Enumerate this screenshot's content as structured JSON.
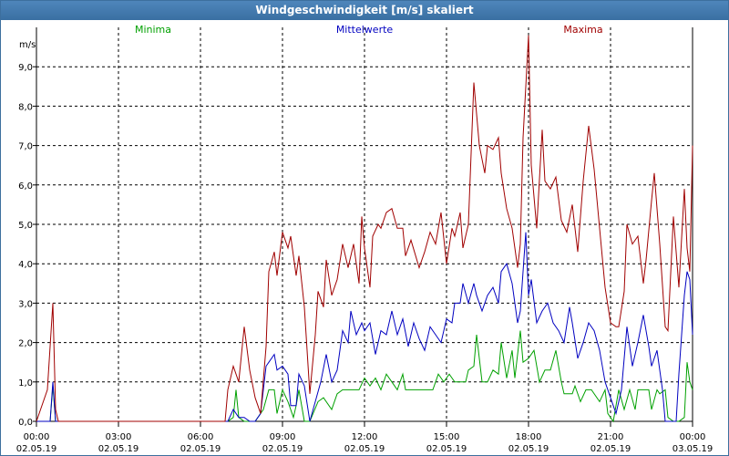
{
  "window": {
    "title": "Windgeschwindigkeit [m/s] skaliert"
  },
  "chart_data": {
    "type": "line",
    "title": "Windgeschwindigkeit [m/s] skaliert",
    "ylabel": "m/s",
    "ylim": [
      0,
      10
    ],
    "xlim": [
      0,
      24
    ],
    "grid": true,
    "legend_position": "top",
    "y_ticks": [
      {
        "value": 0,
        "label": "0,0"
      },
      {
        "value": 1,
        "label": "1,0"
      },
      {
        "value": 2,
        "label": "2,0"
      },
      {
        "value": 3,
        "label": "3,0"
      },
      {
        "value": 4,
        "label": "4,0"
      },
      {
        "value": 5,
        "label": "5,0"
      },
      {
        "value": 6,
        "label": "6,0"
      },
      {
        "value": 7,
        "label": "7,0"
      },
      {
        "value": 8,
        "label": "8,0"
      },
      {
        "value": 9,
        "label": "9,0"
      }
    ],
    "x_ticks": [
      {
        "value": 0,
        "time": "00:00",
        "date": "02.05.19"
      },
      {
        "value": 3,
        "time": "03:00",
        "date": "02.05.19"
      },
      {
        "value": 6,
        "time": "06:00",
        "date": "02.05.19"
      },
      {
        "value": 9,
        "time": "09:00",
        "date": "02.05.19"
      },
      {
        "value": 12,
        "time": "12:00",
        "date": "02.05.19"
      },
      {
        "value": 15,
        "time": "15:00",
        "date": "02.05.19"
      },
      {
        "value": 18,
        "time": "18:00",
        "date": "02.05.19"
      },
      {
        "value": 21,
        "time": "21:00",
        "date": "02.05.19"
      },
      {
        "value": 24,
        "time": "00:00",
        "date": "03.05.19"
      }
    ],
    "series": [
      {
        "name": "Minima",
        "color": "#00a000",
        "points": [
          [
            0,
            0
          ],
          [
            0.5,
            0
          ],
          [
            0.6,
            0.9
          ],
          [
            0.7,
            0
          ],
          [
            1,
            0
          ],
          [
            6.5,
            0
          ],
          [
            7,
            0
          ],
          [
            7.2,
            0.1
          ],
          [
            7.3,
            0.8
          ],
          [
            7.4,
            0.1
          ],
          [
            7.6,
            0
          ],
          [
            8,
            0
          ],
          [
            8.3,
            0.3
          ],
          [
            8.5,
            0.8
          ],
          [
            8.7,
            0.8
          ],
          [
            8.8,
            0.2
          ],
          [
            9,
            0.8
          ],
          [
            9.2,
            0.5
          ],
          [
            9.4,
            0.1
          ],
          [
            9.5,
            0.4
          ],
          [
            9.6,
            0.8
          ],
          [
            9.8,
            0
          ],
          [
            10,
            0
          ],
          [
            10.3,
            0.5
          ],
          [
            10.5,
            0.6
          ],
          [
            10.8,
            0.3
          ],
          [
            11,
            0.7
          ],
          [
            11.2,
            0.8
          ],
          [
            11.5,
            0.8
          ],
          [
            11.8,
            0.8
          ],
          [
            12,
            1.1
          ],
          [
            12.2,
            0.9
          ],
          [
            12.4,
            1.1
          ],
          [
            12.6,
            0.8
          ],
          [
            12.8,
            1.2
          ],
          [
            13,
            1
          ],
          [
            13.2,
            0.8
          ],
          [
            13.4,
            1.2
          ],
          [
            13.5,
            0.8
          ],
          [
            14,
            0.8
          ],
          [
            14.5,
            0.8
          ],
          [
            14.7,
            1.2
          ],
          [
            14.9,
            1
          ],
          [
            15.1,
            1.2
          ],
          [
            15.3,
            1
          ],
          [
            15.5,
            1
          ],
          [
            15.7,
            1
          ],
          [
            15.8,
            1.3
          ],
          [
            16,
            1.4
          ],
          [
            16.1,
            2.2
          ],
          [
            16.3,
            1
          ],
          [
            16.5,
            1
          ],
          [
            16.7,
            1.3
          ],
          [
            16.9,
            1.2
          ],
          [
            17,
            2
          ],
          [
            17.2,
            1.1
          ],
          [
            17.4,
            1.8
          ],
          [
            17.5,
            1.1
          ],
          [
            17.7,
            2.3
          ],
          [
            17.8,
            1.5
          ],
          [
            18,
            1.6
          ],
          [
            18.2,
            1.8
          ],
          [
            18.4,
            1
          ],
          [
            18.6,
            1.3
          ],
          [
            18.8,
            1.3
          ],
          [
            19,
            1.8
          ],
          [
            19.2,
            1
          ],
          [
            19.3,
            0.7
          ],
          [
            19.6,
            0.7
          ],
          [
            19.7,
            0.9
          ],
          [
            19.9,
            0.5
          ],
          [
            20.1,
            0.8
          ],
          [
            20.3,
            0.8
          ],
          [
            20.6,
            0.5
          ],
          [
            20.8,
            0.8
          ],
          [
            20.9,
            0.2
          ],
          [
            21.1,
            0
          ],
          [
            21.3,
            0.8
          ],
          [
            21.5,
            0.3
          ],
          [
            21.7,
            0.8
          ],
          [
            21.9,
            0.3
          ],
          [
            22,
            0.8
          ],
          [
            22.2,
            0.8
          ],
          [
            22.4,
            0.8
          ],
          [
            22.5,
            0.3
          ],
          [
            22.7,
            0.8
          ],
          [
            22.8,
            0.7
          ],
          [
            23,
            0.8
          ],
          [
            23.1,
            0.1
          ],
          [
            23.3,
            0
          ],
          [
            23.5,
            0
          ],
          [
            23.7,
            0.1
          ],
          [
            23.8,
            1.5
          ],
          [
            23.9,
            1
          ],
          [
            24,
            0.8
          ]
        ]
      },
      {
        "name": "Mittelwerte",
        "color": "#0000c0",
        "points": [
          [
            0,
            0
          ],
          [
            0.5,
            0
          ],
          [
            0.6,
            1
          ],
          [
            0.7,
            0
          ],
          [
            1,
            0
          ],
          [
            6.5,
            0
          ],
          [
            7,
            0
          ],
          [
            7.2,
            0.3
          ],
          [
            7.4,
            0.1
          ],
          [
            7.6,
            0.1
          ],
          [
            7.8,
            0
          ],
          [
            8,
            0
          ],
          [
            8.2,
            0.2
          ],
          [
            8.4,
            1.4
          ],
          [
            8.5,
            1.5
          ],
          [
            8.7,
            1.7
          ],
          [
            8.8,
            1.3
          ],
          [
            9,
            1.4
          ],
          [
            9.2,
            1.2
          ],
          [
            9.3,
            0.4
          ],
          [
            9.5,
            0.4
          ],
          [
            9.6,
            1.2
          ],
          [
            9.8,
            0.9
          ],
          [
            10,
            0
          ],
          [
            10.2,
            0.5
          ],
          [
            10.4,
            1
          ],
          [
            10.6,
            1.7
          ],
          [
            10.8,
            1
          ],
          [
            11,
            1.3
          ],
          [
            11.2,
            2.3
          ],
          [
            11.4,
            2
          ],
          [
            11.5,
            2.8
          ],
          [
            11.7,
            2.2
          ],
          [
            11.9,
            2.5
          ],
          [
            12,
            2.3
          ],
          [
            12.2,
            2.5
          ],
          [
            12.4,
            1.7
          ],
          [
            12.6,
            2.3
          ],
          [
            12.8,
            2.2
          ],
          [
            13,
            2.8
          ],
          [
            13.2,
            2.2
          ],
          [
            13.4,
            2.6
          ],
          [
            13.6,
            1.9
          ],
          [
            13.8,
            2.5
          ],
          [
            14,
            2.1
          ],
          [
            14.2,
            1.8
          ],
          [
            14.4,
            2.4
          ],
          [
            14.6,
            2.2
          ],
          [
            14.8,
            2
          ],
          [
            15,
            2.6
          ],
          [
            15.2,
            2.5
          ],
          [
            15.3,
            3
          ],
          [
            15.5,
            3
          ],
          [
            15.6,
            3.5
          ],
          [
            15.8,
            3
          ],
          [
            16,
            3.5
          ],
          [
            16.1,
            3.2
          ],
          [
            16.3,
            2.8
          ],
          [
            16.5,
            3.2
          ],
          [
            16.7,
            3.4
          ],
          [
            16.9,
            3
          ],
          [
            17,
            3.8
          ],
          [
            17.2,
            4
          ],
          [
            17.4,
            3.5
          ],
          [
            17.6,
            2.5
          ],
          [
            17.7,
            2.8
          ],
          [
            17.9,
            4.8
          ],
          [
            18,
            3.2
          ],
          [
            18.1,
            3.6
          ],
          [
            18.3,
            2.5
          ],
          [
            18.5,
            2.8
          ],
          [
            18.7,
            3
          ],
          [
            18.9,
            2.5
          ],
          [
            19.1,
            2.3
          ],
          [
            19.3,
            2
          ],
          [
            19.5,
            2.9
          ],
          [
            19.6,
            2.5
          ],
          [
            19.8,
            1.6
          ],
          [
            20,
            2
          ],
          [
            20.2,
            2.5
          ],
          [
            20.4,
            2.3
          ],
          [
            20.6,
            1.8
          ],
          [
            20.8,
            1
          ],
          [
            21,
            0.6
          ],
          [
            21.2,
            0.2
          ],
          [
            21.4,
            0.8
          ],
          [
            21.6,
            2.4
          ],
          [
            21.8,
            1.4
          ],
          [
            22,
            2
          ],
          [
            22.2,
            2.7
          ],
          [
            22.4,
            1.9
          ],
          [
            22.5,
            1.4
          ],
          [
            22.7,
            1.8
          ],
          [
            22.9,
            0.8
          ],
          [
            23,
            0
          ],
          [
            23.2,
            0
          ],
          [
            23.4,
            0
          ],
          [
            23.5,
            1.2
          ],
          [
            23.7,
            3.2
          ],
          [
            23.8,
            3.8
          ],
          [
            23.9,
            3.6
          ],
          [
            24,
            2.2
          ]
        ]
      },
      {
        "name": "Maxima",
        "color": "#a00000",
        "points": [
          [
            0,
            0
          ],
          [
            0.4,
            0.8
          ],
          [
            0.6,
            3
          ],
          [
            0.7,
            0.3
          ],
          [
            0.8,
            0
          ],
          [
            1,
            0
          ],
          [
            6.5,
            0
          ],
          [
            6.9,
            0
          ],
          [
            7,
            0.8
          ],
          [
            7.2,
            1.4
          ],
          [
            7.4,
            1
          ],
          [
            7.6,
            2.4
          ],
          [
            7.8,
            1.3
          ],
          [
            8,
            0.6
          ],
          [
            8.2,
            0.2
          ],
          [
            8.4,
            1.9
          ],
          [
            8.5,
            3.8
          ],
          [
            8.7,
            4.3
          ],
          [
            8.8,
            3.7
          ],
          [
            9,
            4.8
          ],
          [
            9.2,
            4.4
          ],
          [
            9.3,
            4.7
          ],
          [
            9.5,
            3.7
          ],
          [
            9.6,
            4.2
          ],
          [
            9.8,
            2.9
          ],
          [
            10,
            0.7
          ],
          [
            10.2,
            2.2
          ],
          [
            10.3,
            3.3
          ],
          [
            10.5,
            2.9
          ],
          [
            10.6,
            4.1
          ],
          [
            10.8,
            3.2
          ],
          [
            11,
            3.6
          ],
          [
            11.2,
            4.5
          ],
          [
            11.4,
            3.9
          ],
          [
            11.6,
            4.5
          ],
          [
            11.8,
            3.5
          ],
          [
            11.9,
            5.2
          ],
          [
            12,
            4.4
          ],
          [
            12.2,
            3.4
          ],
          [
            12.3,
            4.7
          ],
          [
            12.5,
            5
          ],
          [
            12.6,
            4.9
          ],
          [
            12.8,
            5.3
          ],
          [
            13,
            5.4
          ],
          [
            13.2,
            4.9
          ],
          [
            13.4,
            4.9
          ],
          [
            13.5,
            4.2
          ],
          [
            13.7,
            4.6
          ],
          [
            14,
            3.9
          ],
          [
            14.2,
            4.3
          ],
          [
            14.4,
            4.8
          ],
          [
            14.6,
            4.5
          ],
          [
            14.8,
            5.3
          ],
          [
            15,
            4
          ],
          [
            15.2,
            4.9
          ],
          [
            15.3,
            4.7
          ],
          [
            15.5,
            5.3
          ],
          [
            15.6,
            4.4
          ],
          [
            15.8,
            5
          ],
          [
            16,
            8.6
          ],
          [
            16.2,
            7
          ],
          [
            16.4,
            6.3
          ],
          [
            16.5,
            7
          ],
          [
            16.7,
            6.9
          ],
          [
            16.9,
            7.2
          ],
          [
            17,
            6.3
          ],
          [
            17.2,
            5.4
          ],
          [
            17.4,
            4.9
          ],
          [
            17.6,
            3.9
          ],
          [
            17.7,
            4.5
          ],
          [
            17.8,
            7.2
          ],
          [
            18,
            9.8
          ],
          [
            18.1,
            6.5
          ],
          [
            18.3,
            4.9
          ],
          [
            18.5,
            7.4
          ],
          [
            18.6,
            6.1
          ],
          [
            18.8,
            5.9
          ],
          [
            19,
            6.2
          ],
          [
            19.2,
            5.1
          ],
          [
            19.4,
            4.8
          ],
          [
            19.6,
            5.5
          ],
          [
            19.8,
            4.3
          ],
          [
            20,
            6.1
          ],
          [
            20.2,
            7.5
          ],
          [
            20.4,
            6.4
          ],
          [
            20.6,
            4.9
          ],
          [
            20.8,
            3.4
          ],
          [
            21,
            2.5
          ],
          [
            21.2,
            2.4
          ],
          [
            21.3,
            2.4
          ],
          [
            21.5,
            3.3
          ],
          [
            21.6,
            5
          ],
          [
            21.8,
            4.5
          ],
          [
            22,
            4.7
          ],
          [
            22.2,
            3.5
          ],
          [
            22.3,
            4.1
          ],
          [
            22.5,
            5.6
          ],
          [
            22.6,
            6.3
          ],
          [
            22.8,
            4.5
          ],
          [
            23,
            2.4
          ],
          [
            23.1,
            2.3
          ],
          [
            23.3,
            5.2
          ],
          [
            23.5,
            3.4
          ],
          [
            23.7,
            5.9
          ],
          [
            23.8,
            4.4
          ],
          [
            23.9,
            3.8
          ],
          [
            24,
            7
          ]
        ]
      }
    ]
  }
}
